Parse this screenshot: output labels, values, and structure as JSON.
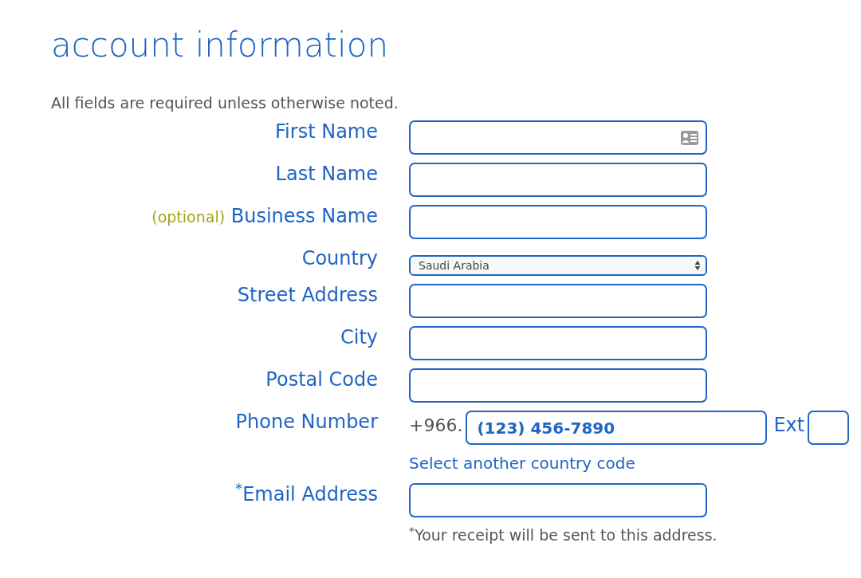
{
  "title": "account information",
  "intro": "All fields are required unless otherwise noted.",
  "fields": [
    {
      "kind": "text",
      "label": "First Name",
      "autofill_icon": true
    },
    {
      "kind": "text",
      "label": "Last Name",
      "autofill_icon": false
    },
    {
      "kind": "text",
      "label": "Business Name",
      "optional": "(optional)",
      "autofill_icon": false
    },
    {
      "kind": "select",
      "label": "Country",
      "value": "Saudi Arabia"
    },
    {
      "kind": "text",
      "label": "Street Address",
      "autofill_icon": false
    },
    {
      "kind": "text",
      "label": "City",
      "autofill_icon": false
    },
    {
      "kind": "text",
      "label": "Postal Code",
      "autofill_icon": false
    },
    {
      "kind": "phone",
      "label": "Phone Number",
      "prefix": "+966.",
      "value": "(123) 456-7890",
      "ext_label": "Ext",
      "link": "Select another country code"
    },
    {
      "kind": "text",
      "label": "$^{*}$Email Address",
      "autofill_icon": false,
      "note": "$^{*}$Your receipt will be sent to this address."
    }
  ]
}
